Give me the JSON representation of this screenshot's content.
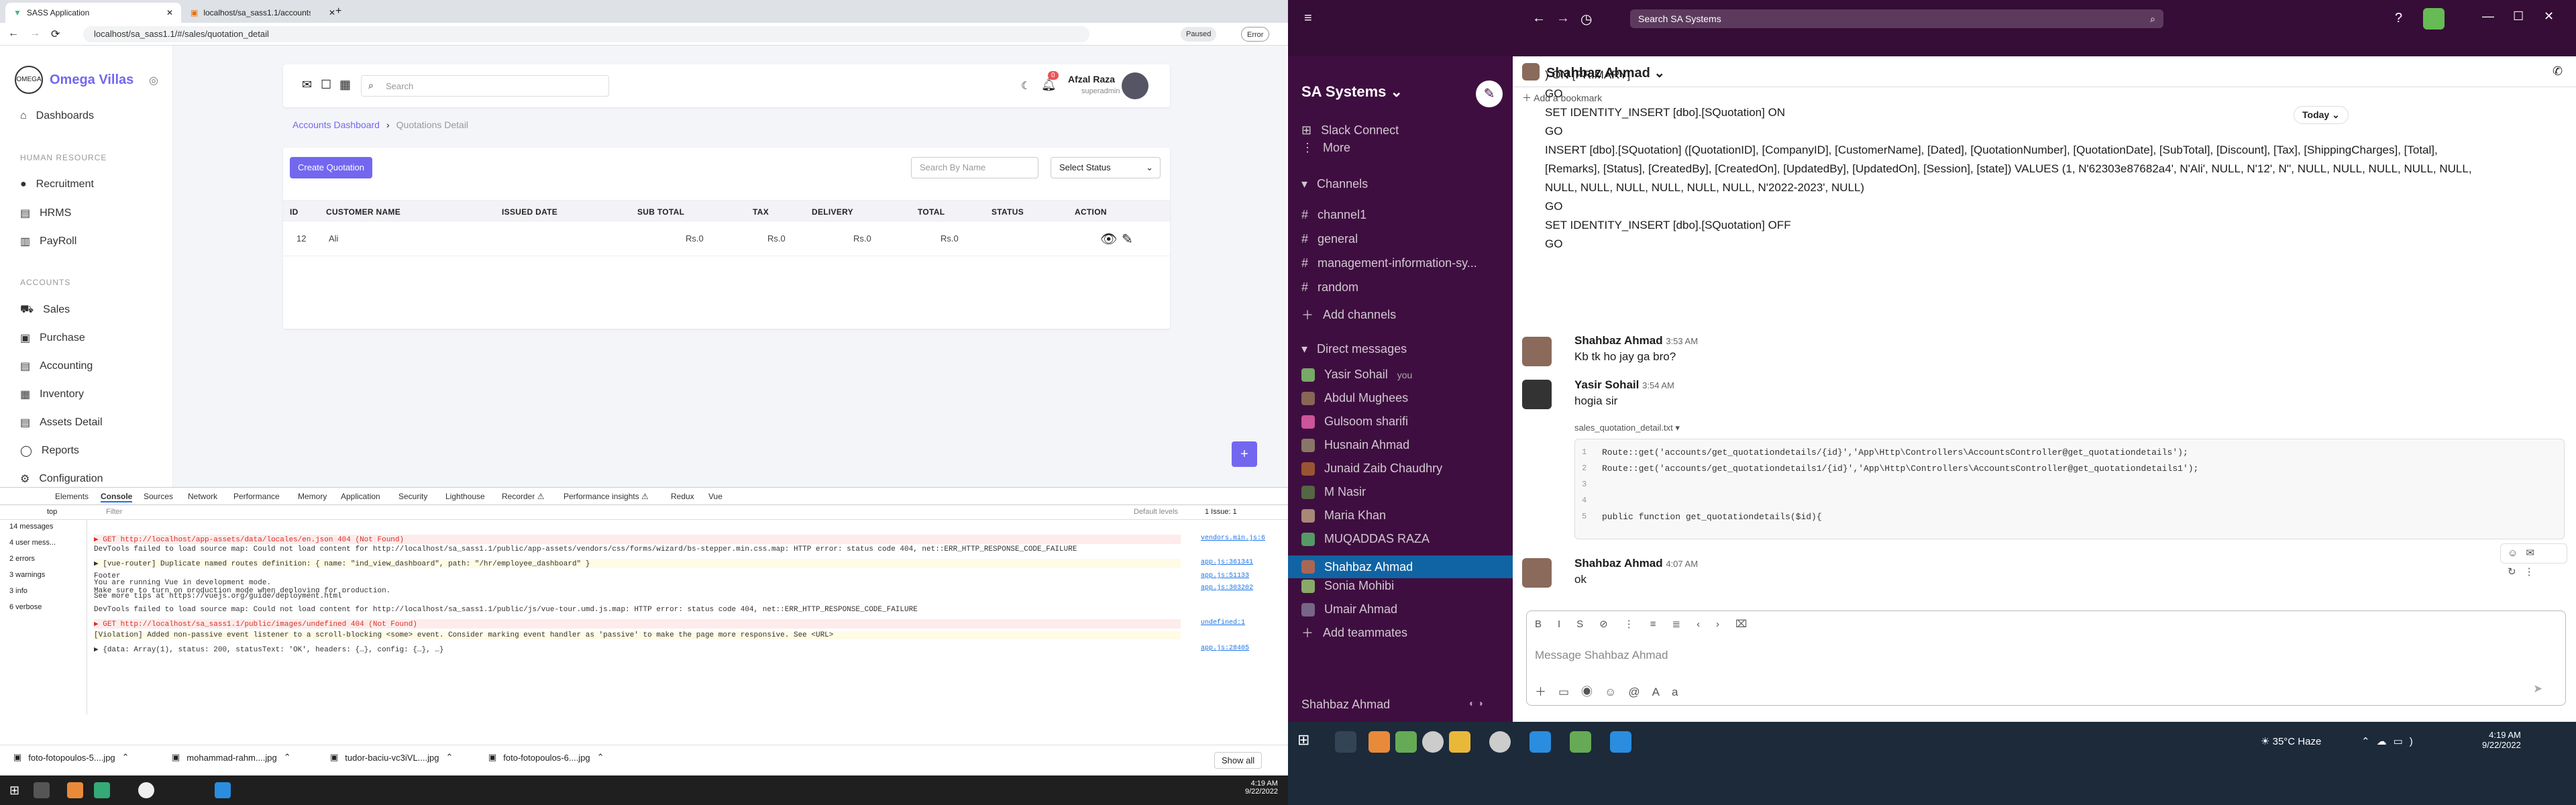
{
  "browser": {
    "tab1": "SASS Application",
    "tab2": "localhost/sa_sass1.1/accounts/q...",
    "url": "localhost/sa_sass1.1/#/sales/quotation_detail",
    "paused": "Paused",
    "error": "Error"
  },
  "app": {
    "brand": "Omega Villas",
    "nav": {
      "dashboards": "Dashboards",
      "human_resource": "HUMAN RESOURCE",
      "recruitment": "Recruitment",
      "hrms": "HRMS",
      "payroll": "PayRoll",
      "accounts": "ACCOUNTS",
      "sales": "Sales",
      "purchase": "Purchase",
      "accounting": "Accounting",
      "inventory": "Inventory",
      "assets": "Assets Detail",
      "reports": "Reports",
      "configuration": "Configuration"
    },
    "search_placeholder": "Search",
    "user_name": "Afzal Raza",
    "user_role": "superadmin",
    "notif_count": "0",
    "breadcrumb_root": "Accounts Dashboard",
    "breadcrumb_current": "Quotations Detail",
    "create_button": "Create Quotation",
    "search_name_placeholder": "Search By Name",
    "status_select": "Select Status",
    "table": {
      "headers": [
        "ID",
        "CUSTOMER NAME",
        "ISSUED DATE",
        "SUB TOTAL",
        "TAX",
        "DELIVERY",
        "TOTAL",
        "STATUS",
        "ACTION"
      ],
      "rows": [
        {
          "id": "12",
          "customer": "Ali",
          "issued": "",
          "subtotal": "Rs.0",
          "tax": "Rs.0",
          "delivery": "Rs.0",
          "total": "Rs.0",
          "status": ""
        }
      ]
    }
  },
  "devtools": {
    "tabs": [
      "Elements",
      "Console",
      "Sources",
      "Network",
      "Performance",
      "Memory",
      "Application",
      "Security",
      "Lighthouse",
      "Recorder ⚠",
      "Performance insights ⚠",
      "Redux",
      "Vue"
    ],
    "context": "top",
    "filter": "Filter",
    "levels": "Default levels",
    "issues": "1 Issue: 1",
    "counts": {
      "errors": "2",
      "warnings": "1",
      "info": "1"
    },
    "sidebar": [
      "14 messages",
      "4 user mess...",
      "2 errors",
      "3 warnings",
      "3 info",
      "6 verbose"
    ],
    "lines": [
      "▶ GET http://localhost/app-assets/data/locales/en.json 404 (Not Found)",
      "DevTools failed to load source map: Could not load content for http://localhost/sa_sass1.1/public/app-assets/vendors/css/forms/wizard/bs-stepper.min.css.map: HTTP error: status code 404, net::ERR_HTTP_RESPONSE_CODE_FAILURE",
      "▶ [vue-router] Duplicate named routes definition: { name: \"ind_view_dashboard\", path: \"/hr/employee_dashboard\" }",
      "Footer",
      "You are running Vue in development mode.",
      "Make sure to turn on production mode when deploying for production.",
      "See more tips at https://vuejs.org/guide/deployment.html",
      "DevTools failed to load source map: Could not load content for http://localhost/sa_sass1.1/public/js/vue-tour.umd.js.map: HTTP error: status code 404, net::ERR_HTTP_RESPONSE_CODE_FAILURE",
      "▶ GET http://localhost/sa_sass1.1/public/images/undefined 404 (Not Found)",
      "[Violation] Added non-passive event listener to a scroll-blocking <some> event. Consider marking event handler as 'passive' to make the page more responsive. See <URL>",
      "▶ {data: Array(1), status: 200, statusText: 'OK', headers: {…}, config: {…}, …}"
    ],
    "sources": [
      "vendors.min.js:6",
      "app.js:361341",
      "app.js:51133",
      "app.js:303202",
      "undefined:1",
      "app.js:28405"
    ]
  },
  "downloads": {
    "items": [
      "foto-fotopoulos-5....jpg",
      "mohammad-rahm....jpg",
      "tudor-baciu-vc3iVL....jpg",
      "foto-fotopoulos-6....jpg"
    ],
    "show_all": "Show all"
  },
  "taskbar_left": {
    "time": "4:19 AM",
    "date": "9/22/2022"
  },
  "slack": {
    "search": "Search SA Systems",
    "workspace": "SA Systems",
    "nav": [
      "Slack Connect",
      "More"
    ],
    "channels_head": "Channels",
    "channels": [
      "channel1",
      "general",
      "management-information-sy...",
      "random"
    ],
    "add_channels": "Add channels",
    "dm_head": "Direct messages",
    "dms": [
      "Yasir Sohail",
      "Abdul Mughees",
      "Gulsoom sharifi",
      "Husnain Ahmad",
      "Junaid Zaib Chaudhry",
      "M Nasir",
      "Maria Khan",
      "MUQADDAS RAZA",
      "Shahbaz Ahmad",
      "Sonia Mohibi",
      "Umair Ahmad"
    ],
    "you": "you",
    "add_teammates": "Add teammates",
    "footer_user": "Shahbaz Ahmad",
    "channel_title": "Shahbaz Ahmad",
    "add_bookmark": "Add a bookmark",
    "today": "Today",
    "code_lines": [
      ") ON [PRIMARY]",
      "GO",
      "SET IDENTITY_INSERT [dbo].[SQuotation] ON",
      "GO",
      "INSERT [dbo].[SQuotation] ([QuotationID], [CompanyID], [CustomerName], [Dated], [QuotationNumber], [QuotationDate], [SubTotal], [Discount], [Tax], [ShippingCharges], [Total],",
      "[Remarks], [Status], [CreatedBy], [CreatedOn], [UpdatedBy], [UpdatedOn], [Session], [state]) VALUES (1, N'62303e87682a4', N'Ali', NULL, N'12', N'', NULL, NULL, NULL, NULL, NULL,",
      "NULL, NULL, NULL, NULL, NULL, NULL, N'2022-2023', NULL)",
      "GO",
      "SET IDENTITY_INSERT [dbo].[SQuotation] OFF",
      "GO"
    ],
    "messages": [
      {
        "author": "Shahbaz Ahmad",
        "time": "3:53 AM",
        "text": "Kb tk ho jay ga bro?"
      },
      {
        "author": "Yasir Sohail",
        "time": "3:54 AM",
        "text": "hogia sir"
      },
      {
        "author": "Shahbaz Ahmad",
        "time": "4:07 AM",
        "text": "ok"
      }
    ],
    "file_name": "sales_quotation_detail.txt",
    "snippet": [
      "Route::get('accounts/get_quotationdetails/{id}','App\\Http\\Controllers\\AccountsController@get_quotationdetails');",
      "Route::get('accounts/get_quotationdetails1/{id}','App\\Http\\Controllers\\AccountsController@get_quotationdetails1');",
      "",
      "",
      " public function get_quotationdetails($id){"
    ],
    "snippet_nums": [
      "1",
      "2",
      "3",
      "4",
      "5"
    ],
    "composer_placeholder": "Message Shahbaz Ahmad"
  },
  "taskbar_right": {
    "weather": "35°C Haze",
    "time": "4:19 AM",
    "date": "9/22/2022"
  }
}
